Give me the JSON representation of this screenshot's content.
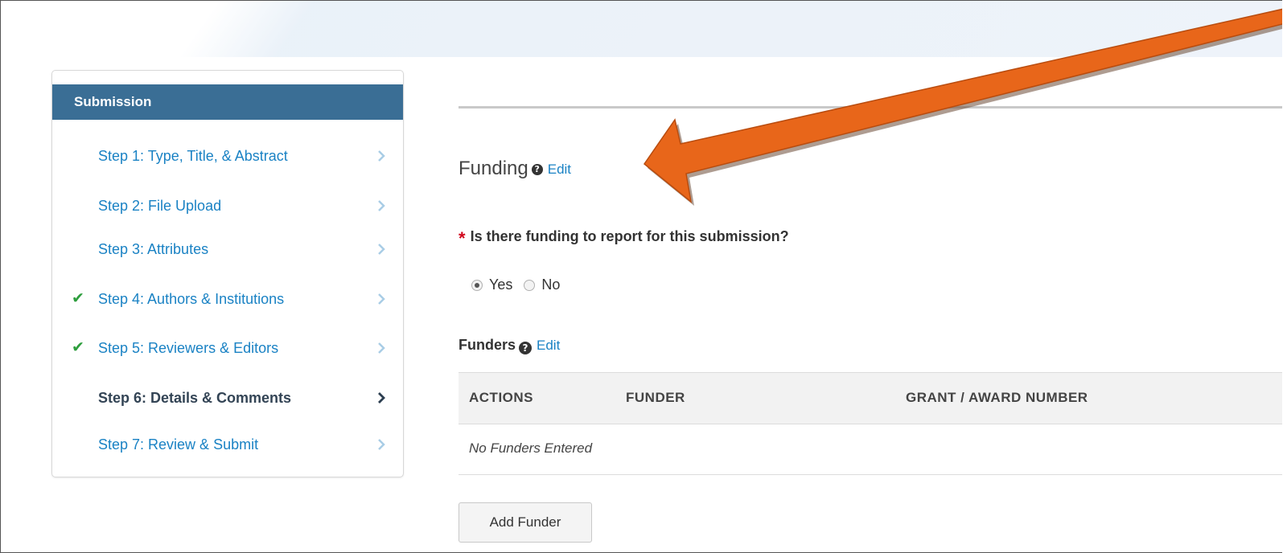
{
  "sidebar": {
    "title": "Submission",
    "steps": [
      {
        "label": "Step 1: Type, Title, & Abstract",
        "completed": false,
        "active": false
      },
      {
        "label": "Step 2: File Upload",
        "completed": false,
        "active": false
      },
      {
        "label": "Step 3: Attributes",
        "completed": false,
        "active": false
      },
      {
        "label": "Step 4: Authors & Institutions",
        "completed": true,
        "active": false
      },
      {
        "label": "Step 5: Reviewers & Editors",
        "completed": true,
        "active": false
      },
      {
        "label": "Step 6: Details & Comments",
        "completed": false,
        "active": true
      },
      {
        "label": "Step 7: Review & Submit",
        "completed": false,
        "active": false
      }
    ],
    "check_icon": "✔"
  },
  "funding": {
    "title": "Funding",
    "help_icon": "?",
    "edit_label": "Edit",
    "question": "Is there funding to report for this submission?",
    "required_marker": "*",
    "options": {
      "yes": "Yes",
      "no": "No"
    },
    "selected": "Yes"
  },
  "funders": {
    "title": "Funders",
    "edit_label": "Edit",
    "columns": [
      "ACTIONS",
      "FUNDER",
      "GRANT / AWARD NUMBER"
    ],
    "empty_message": "No Funders Entered",
    "add_button": "Add Funder"
  },
  "colors": {
    "header_bg": "#3a6e95",
    "link": "#1a82c4",
    "check": "#2e9e3e",
    "required": "#d0021b",
    "annotation_arrow": "#e8661a"
  }
}
